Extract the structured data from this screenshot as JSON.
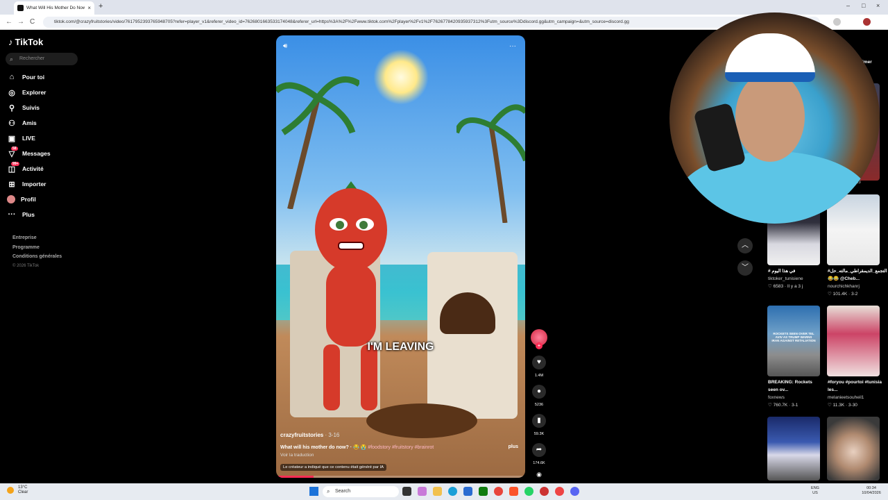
{
  "browser": {
    "tab_title": "What Will His Mother Do Now?",
    "url": "tiktok.com/@crazyfruitstories/video/7617952393765948705?refer=player_v1&referer_video_id=7626801663533174048&referer_url=https%3A%2F%2Fwww.tiktok.com%2Fplayer%2Fv1%2F7626778420935937312%3Futm_source%3Ddiscord.gg&utm_campaign=&utm_source=discord.gg",
    "new_tab": "+",
    "close": "×",
    "back": "←",
    "forward": "→",
    "reload": "C",
    "minimize": "–",
    "maximize": "□",
    "win_close": "×"
  },
  "sidebar": {
    "logo": "TikTok",
    "search_placeholder": "Rechercher",
    "items": [
      {
        "label": "Pour toi",
        "icon": "home-icon"
      },
      {
        "label": "Explorer",
        "icon": "compass-icon"
      },
      {
        "label": "Suivis",
        "icon": "user-plus-icon"
      },
      {
        "label": "Amis",
        "icon": "friends-icon"
      },
      {
        "label": "LIVE",
        "icon": "live-icon"
      },
      {
        "label": "Messages",
        "icon": "messages-icon",
        "badge": "58"
      },
      {
        "label": "Activité",
        "icon": "activity-icon",
        "badge": "99+"
      },
      {
        "label": "Importer",
        "icon": "upload-icon"
      },
      {
        "label": "Profil",
        "icon": "profile-icon"
      },
      {
        "label": "Plus",
        "icon": "more-icon"
      }
    ],
    "footer": [
      "Entreprise",
      "Programme",
      "Conditions générales"
    ],
    "copyright": "© 2026 TikTok"
  },
  "video": {
    "overlay_text": "I'M LEAVING",
    "author": "crazyfruitstories",
    "date": " · 3-16",
    "description": "What will his mother do now? · 😂 😭",
    "hashtags": " #foodstory #fruitstory #brainrot",
    "translate": "Voir la traduction",
    "plus": "plus",
    "ai_label": "Le créateur a indiqué que ce contenu était généré par IA",
    "progress": 0.15
  },
  "actions": {
    "likes": "1.4M",
    "comments": "5236",
    "saves": "59.3K",
    "shares": "174.6K"
  },
  "right_pane": {
    "top_text": "imer",
    "partial_count": "13",
    "thumbs": [
      {
        "title": "في هذا اليوم #",
        "user": "tiktoker_tunisiene",
        "meta": "♡ 6583 · Il y a 3 j"
      },
      {
        "title": "#التجمع_الديمقراطي_مالته_حل 😂😂 @Cheb...",
        "user": "nourchichkhanrj",
        "meta": "♡ 101.4K · 3-2"
      },
      {
        "title": "BREAKING: Rockets seen ov...",
        "user": "foxnews",
        "meta": "♡ 760.7K · 3-1"
      },
      {
        "title": "#foryou #pourtoi #tunisia les...",
        "user": "melanieetsouheil1",
        "meta": "♡ 11.3K · 3-30"
      }
    ],
    "thumb_overlay": "ROCKETS SEEN OVER TEL AVIV AS TRUMP WARNS IRAN AGAINST RETALIATION"
  },
  "taskbar": {
    "temp": "13°C",
    "weather": "Clear",
    "search": "Search",
    "lang": "ENG",
    "region": "US",
    "time": "00:34",
    "date": "10/04/2026"
  }
}
